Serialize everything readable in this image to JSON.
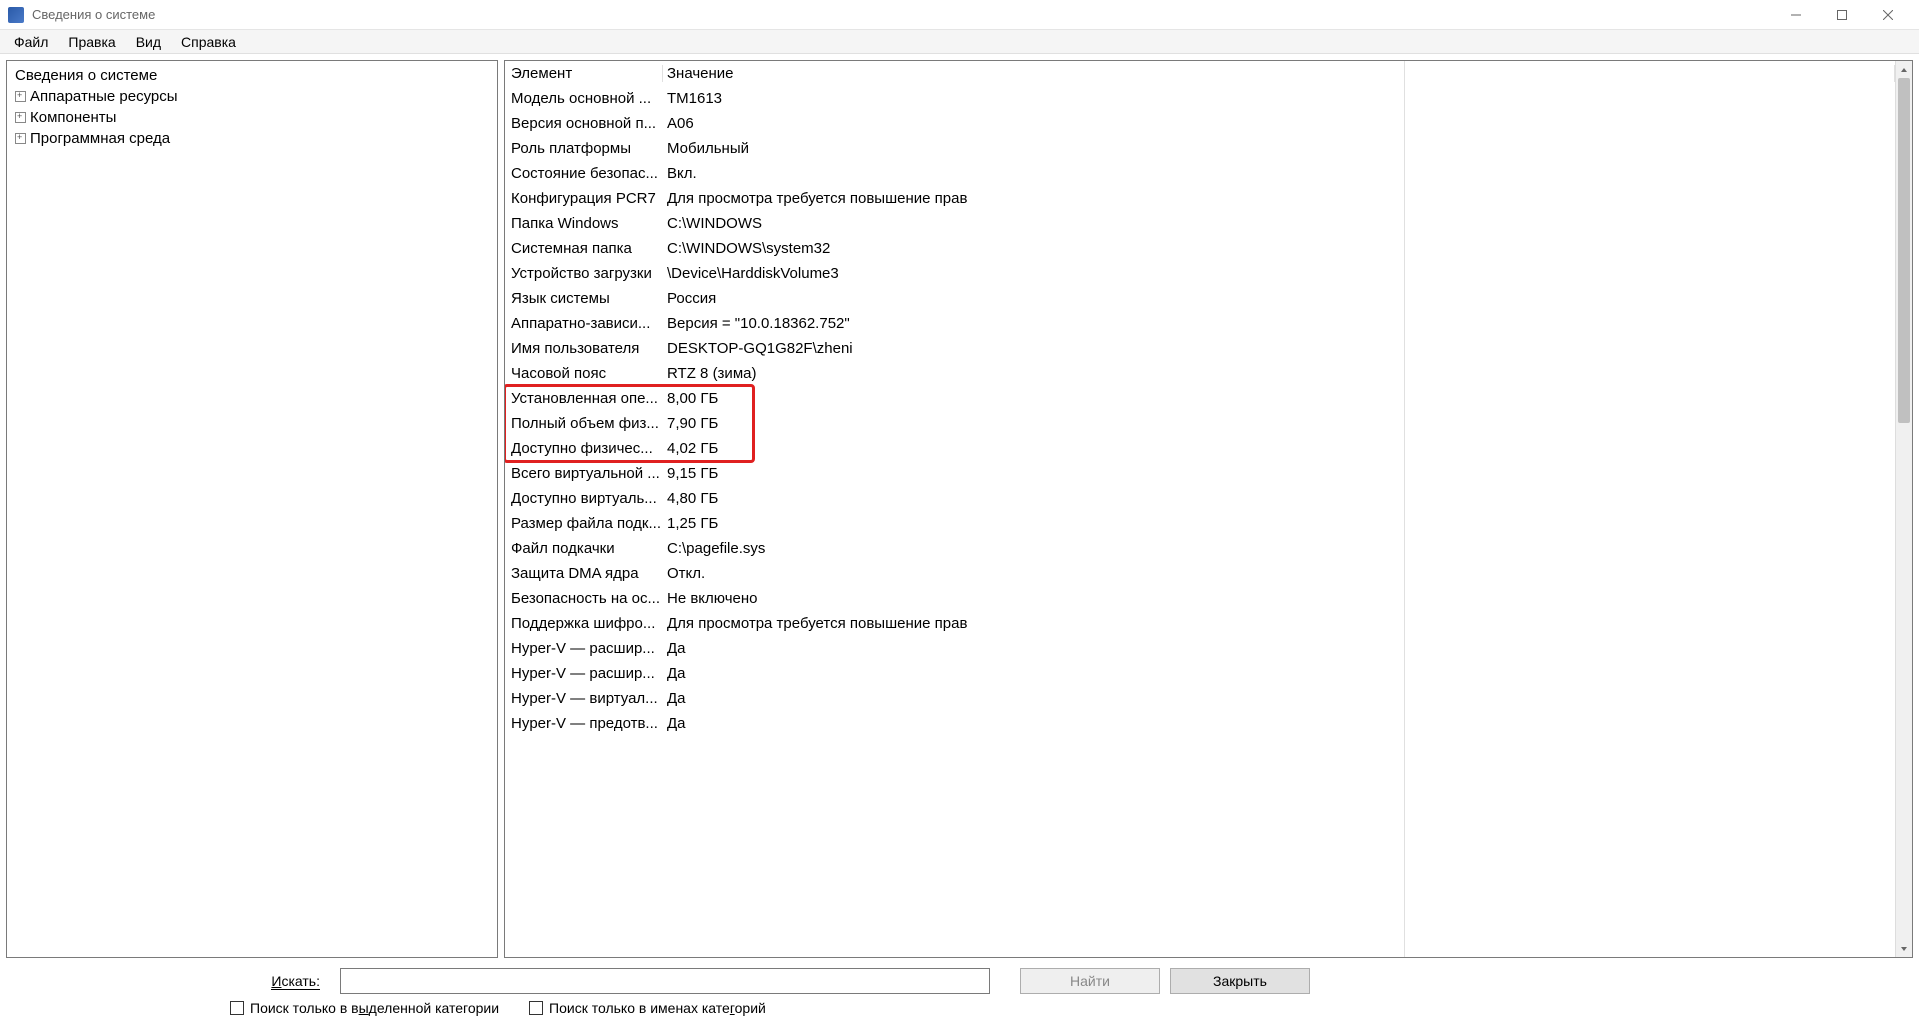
{
  "window": {
    "title": "Сведения о системе"
  },
  "menu": {
    "items": [
      "Файл",
      "Правка",
      "Вид",
      "Справка"
    ]
  },
  "tree": {
    "root": "Сведения о системе",
    "children": [
      "Аппаратные ресурсы",
      "Компоненты",
      "Программная среда"
    ]
  },
  "grid": {
    "header_name": "Элемент",
    "header_value": "Значение",
    "rows": [
      {
        "name": "Модель основной ...",
        "value": "TM1613"
      },
      {
        "name": "Версия основной п...",
        "value": "A06"
      },
      {
        "name": "Роль платформы",
        "value": "Мобильный"
      },
      {
        "name": "Состояние безопас...",
        "value": "Вкл."
      },
      {
        "name": "Конфигурация PCR7",
        "value": "Для просмотра требуется повышение прав"
      },
      {
        "name": "Папка Windows",
        "value": "C:\\WINDOWS"
      },
      {
        "name": "Системная папка",
        "value": "C:\\WINDOWS\\system32"
      },
      {
        "name": "Устройство загрузки",
        "value": "\\Device\\HarddiskVolume3"
      },
      {
        "name": "Язык системы",
        "value": "Россия"
      },
      {
        "name": "Аппаратно-зависи...",
        "value": "Версия = \"10.0.18362.752\""
      },
      {
        "name": "Имя пользователя",
        "value": "DESKTOP-GQ1G82F\\zheni"
      },
      {
        "name": "Часовой пояс",
        "value": "RTZ 8 (зима)"
      },
      {
        "name": "Установленная опе...",
        "value": "8,00 ГБ",
        "hl": true
      },
      {
        "name": "Полный объем физ...",
        "value": "7,90 ГБ",
        "hl": true
      },
      {
        "name": "Доступно физичес...",
        "value": "4,02 ГБ",
        "hl": true
      },
      {
        "name": "Всего виртуальной ...",
        "value": "9,15 ГБ"
      },
      {
        "name": "Доступно виртуаль...",
        "value": "4,80 ГБ"
      },
      {
        "name": "Размер файла подк...",
        "value": "1,25 ГБ"
      },
      {
        "name": "Файл подкачки",
        "value": "C:\\pagefile.sys"
      },
      {
        "name": "Защита DMA ядра",
        "value": "Откл."
      },
      {
        "name": "Безопасность на ос...",
        "value": "Не включено"
      },
      {
        "name": "Поддержка шифро...",
        "value": "Для просмотра требуется повышение прав"
      },
      {
        "name": "Hyper-V — расшир...",
        "value": "Да"
      },
      {
        "name": "Hyper-V — расшир...",
        "value": "Да"
      },
      {
        "name": "Hyper-V — виртуал...",
        "value": "Да"
      },
      {
        "name": "Hyper-V — предотв...",
        "value": "Да"
      }
    ]
  },
  "footer": {
    "search_label_plain": "Искать:",
    "search_underline": "И",
    "search_rest": "скать:",
    "find_btn": "Найти",
    "close_btn": "Закрыть",
    "chk1_pre": "Поиск только в в",
    "chk1_ul": "ы",
    "chk1_post": "деленной категории",
    "chk2_pre": "Поиск только в именах кате",
    "chk2_ul": "г",
    "chk2_post": "орий"
  }
}
